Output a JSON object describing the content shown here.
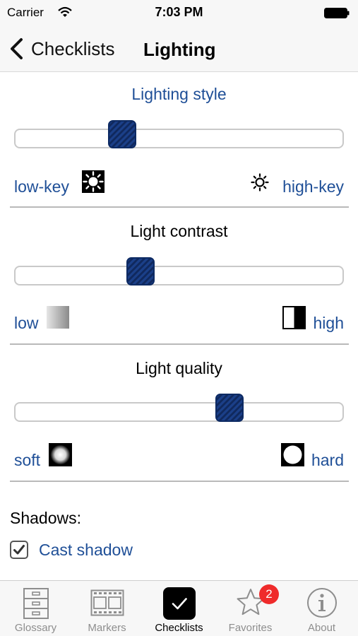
{
  "status_bar": {
    "carrier": "Carrier",
    "time": "7:03 PM"
  },
  "nav": {
    "back_label": "Checklists",
    "title": "Lighting"
  },
  "sections": [
    {
      "title": "Lighting style",
      "value": 0.31,
      "low_label": "low-key",
      "high_label": "high-key",
      "low_icon": "sun-inverted-icon",
      "high_icon": "sun-outline-icon"
    },
    {
      "title": "Light contrast",
      "value": 0.37,
      "low_label": "low",
      "high_label": "high",
      "low_icon": "gradient-low-contrast-icon",
      "high_icon": "half-black-white-icon"
    },
    {
      "title": "Light quality",
      "value": 0.67,
      "low_label": "soft",
      "high_label": "hard",
      "low_icon": "soft-light-circle-icon",
      "high_icon": "hard-light-circle-icon"
    }
  ],
  "shadows": {
    "heading": "Shadows:",
    "cast_shadow_label": "Cast shadow",
    "cast_shadow_checked": true
  },
  "tabs": [
    {
      "label": "Glossary",
      "icon": "cabinet-icon",
      "active": false
    },
    {
      "label": "Markers",
      "icon": "film-strip-icon",
      "active": false
    },
    {
      "label": "Checklists",
      "icon": "checkmark-icon",
      "active": true
    },
    {
      "label": "Favorites",
      "icon": "star-icon",
      "active": false,
      "badge": "2"
    },
    {
      "label": "About",
      "icon": "info-icon",
      "active": false
    }
  ],
  "colors": {
    "accent": "#1f4f97",
    "thumb": "#1b3f88",
    "badge": "#ef2b2b"
  }
}
